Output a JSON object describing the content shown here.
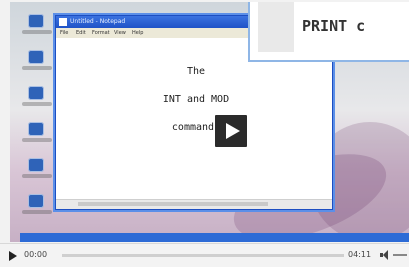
{
  "window": {
    "title": "Untitled - Notepad",
    "menu": [
      "File",
      "Edit",
      "Format",
      "View",
      "Help"
    ]
  },
  "document": {
    "lines": [
      "The",
      "INT and MOD",
      "commands"
    ]
  },
  "popup": {
    "text": "PRINT c"
  },
  "player": {
    "current_time": "00:00",
    "duration": "04:11",
    "progress": 0,
    "colors": {
      "accent": "#d12020",
      "taskbar": "#2d6bd6"
    }
  },
  "icons": [
    "play-icon",
    "volume-icon"
  ]
}
